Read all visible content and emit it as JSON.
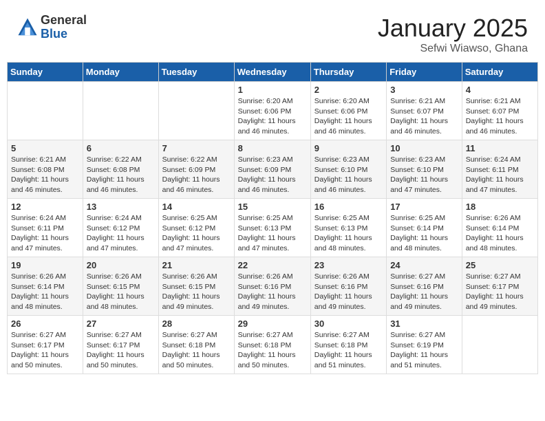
{
  "logo": {
    "general": "General",
    "blue": "Blue"
  },
  "header": {
    "month": "January 2025",
    "location": "Sefwi Wiawso, Ghana"
  },
  "weekdays": [
    "Sunday",
    "Monday",
    "Tuesday",
    "Wednesday",
    "Thursday",
    "Friday",
    "Saturday"
  ],
  "weeks": [
    [
      {
        "day": "",
        "sunrise": "",
        "sunset": "",
        "daylight": ""
      },
      {
        "day": "",
        "sunrise": "",
        "sunset": "",
        "daylight": ""
      },
      {
        "day": "",
        "sunrise": "",
        "sunset": "",
        "daylight": ""
      },
      {
        "day": "1",
        "sunrise": "Sunrise: 6:20 AM",
        "sunset": "Sunset: 6:06 PM",
        "daylight": "Daylight: 11 hours and 46 minutes."
      },
      {
        "day": "2",
        "sunrise": "Sunrise: 6:20 AM",
        "sunset": "Sunset: 6:06 PM",
        "daylight": "Daylight: 11 hours and 46 minutes."
      },
      {
        "day": "3",
        "sunrise": "Sunrise: 6:21 AM",
        "sunset": "Sunset: 6:07 PM",
        "daylight": "Daylight: 11 hours and 46 minutes."
      },
      {
        "day": "4",
        "sunrise": "Sunrise: 6:21 AM",
        "sunset": "Sunset: 6:07 PM",
        "daylight": "Daylight: 11 hours and 46 minutes."
      }
    ],
    [
      {
        "day": "5",
        "sunrise": "Sunrise: 6:21 AM",
        "sunset": "Sunset: 6:08 PM",
        "daylight": "Daylight: 11 hours and 46 minutes."
      },
      {
        "day": "6",
        "sunrise": "Sunrise: 6:22 AM",
        "sunset": "Sunset: 6:08 PM",
        "daylight": "Daylight: 11 hours and 46 minutes."
      },
      {
        "day": "7",
        "sunrise": "Sunrise: 6:22 AM",
        "sunset": "Sunset: 6:09 PM",
        "daylight": "Daylight: 11 hours and 46 minutes."
      },
      {
        "day": "8",
        "sunrise": "Sunrise: 6:23 AM",
        "sunset": "Sunset: 6:09 PM",
        "daylight": "Daylight: 11 hours and 46 minutes."
      },
      {
        "day": "9",
        "sunrise": "Sunrise: 6:23 AM",
        "sunset": "Sunset: 6:10 PM",
        "daylight": "Daylight: 11 hours and 46 minutes."
      },
      {
        "day": "10",
        "sunrise": "Sunrise: 6:23 AM",
        "sunset": "Sunset: 6:10 PM",
        "daylight": "Daylight: 11 hours and 47 minutes."
      },
      {
        "day": "11",
        "sunrise": "Sunrise: 6:24 AM",
        "sunset": "Sunset: 6:11 PM",
        "daylight": "Daylight: 11 hours and 47 minutes."
      }
    ],
    [
      {
        "day": "12",
        "sunrise": "Sunrise: 6:24 AM",
        "sunset": "Sunset: 6:11 PM",
        "daylight": "Daylight: 11 hours and 47 minutes."
      },
      {
        "day": "13",
        "sunrise": "Sunrise: 6:24 AM",
        "sunset": "Sunset: 6:12 PM",
        "daylight": "Daylight: 11 hours and 47 minutes."
      },
      {
        "day": "14",
        "sunrise": "Sunrise: 6:25 AM",
        "sunset": "Sunset: 6:12 PM",
        "daylight": "Daylight: 11 hours and 47 minutes."
      },
      {
        "day": "15",
        "sunrise": "Sunrise: 6:25 AM",
        "sunset": "Sunset: 6:13 PM",
        "daylight": "Daylight: 11 hours and 47 minutes."
      },
      {
        "day": "16",
        "sunrise": "Sunrise: 6:25 AM",
        "sunset": "Sunset: 6:13 PM",
        "daylight": "Daylight: 11 hours and 48 minutes."
      },
      {
        "day": "17",
        "sunrise": "Sunrise: 6:25 AM",
        "sunset": "Sunset: 6:14 PM",
        "daylight": "Daylight: 11 hours and 48 minutes."
      },
      {
        "day": "18",
        "sunrise": "Sunrise: 6:26 AM",
        "sunset": "Sunset: 6:14 PM",
        "daylight": "Daylight: 11 hours and 48 minutes."
      }
    ],
    [
      {
        "day": "19",
        "sunrise": "Sunrise: 6:26 AM",
        "sunset": "Sunset: 6:14 PM",
        "daylight": "Daylight: 11 hours and 48 minutes."
      },
      {
        "day": "20",
        "sunrise": "Sunrise: 6:26 AM",
        "sunset": "Sunset: 6:15 PM",
        "daylight": "Daylight: 11 hours and 48 minutes."
      },
      {
        "day": "21",
        "sunrise": "Sunrise: 6:26 AM",
        "sunset": "Sunset: 6:15 PM",
        "daylight": "Daylight: 11 hours and 49 minutes."
      },
      {
        "day": "22",
        "sunrise": "Sunrise: 6:26 AM",
        "sunset": "Sunset: 6:16 PM",
        "daylight": "Daylight: 11 hours and 49 minutes."
      },
      {
        "day": "23",
        "sunrise": "Sunrise: 6:26 AM",
        "sunset": "Sunset: 6:16 PM",
        "daylight": "Daylight: 11 hours and 49 minutes."
      },
      {
        "day": "24",
        "sunrise": "Sunrise: 6:27 AM",
        "sunset": "Sunset: 6:16 PM",
        "daylight": "Daylight: 11 hours and 49 minutes."
      },
      {
        "day": "25",
        "sunrise": "Sunrise: 6:27 AM",
        "sunset": "Sunset: 6:17 PM",
        "daylight": "Daylight: 11 hours and 49 minutes."
      }
    ],
    [
      {
        "day": "26",
        "sunrise": "Sunrise: 6:27 AM",
        "sunset": "Sunset: 6:17 PM",
        "daylight": "Daylight: 11 hours and 50 minutes."
      },
      {
        "day": "27",
        "sunrise": "Sunrise: 6:27 AM",
        "sunset": "Sunset: 6:17 PM",
        "daylight": "Daylight: 11 hours and 50 minutes."
      },
      {
        "day": "28",
        "sunrise": "Sunrise: 6:27 AM",
        "sunset": "Sunset: 6:18 PM",
        "daylight": "Daylight: 11 hours and 50 minutes."
      },
      {
        "day": "29",
        "sunrise": "Sunrise: 6:27 AM",
        "sunset": "Sunset: 6:18 PM",
        "daylight": "Daylight: 11 hours and 50 minutes."
      },
      {
        "day": "30",
        "sunrise": "Sunrise: 6:27 AM",
        "sunset": "Sunset: 6:18 PM",
        "daylight": "Daylight: 11 hours and 51 minutes."
      },
      {
        "day": "31",
        "sunrise": "Sunrise: 6:27 AM",
        "sunset": "Sunset: 6:19 PM",
        "daylight": "Daylight: 11 hours and 51 minutes."
      },
      {
        "day": "",
        "sunrise": "",
        "sunset": "",
        "daylight": ""
      }
    ]
  ]
}
